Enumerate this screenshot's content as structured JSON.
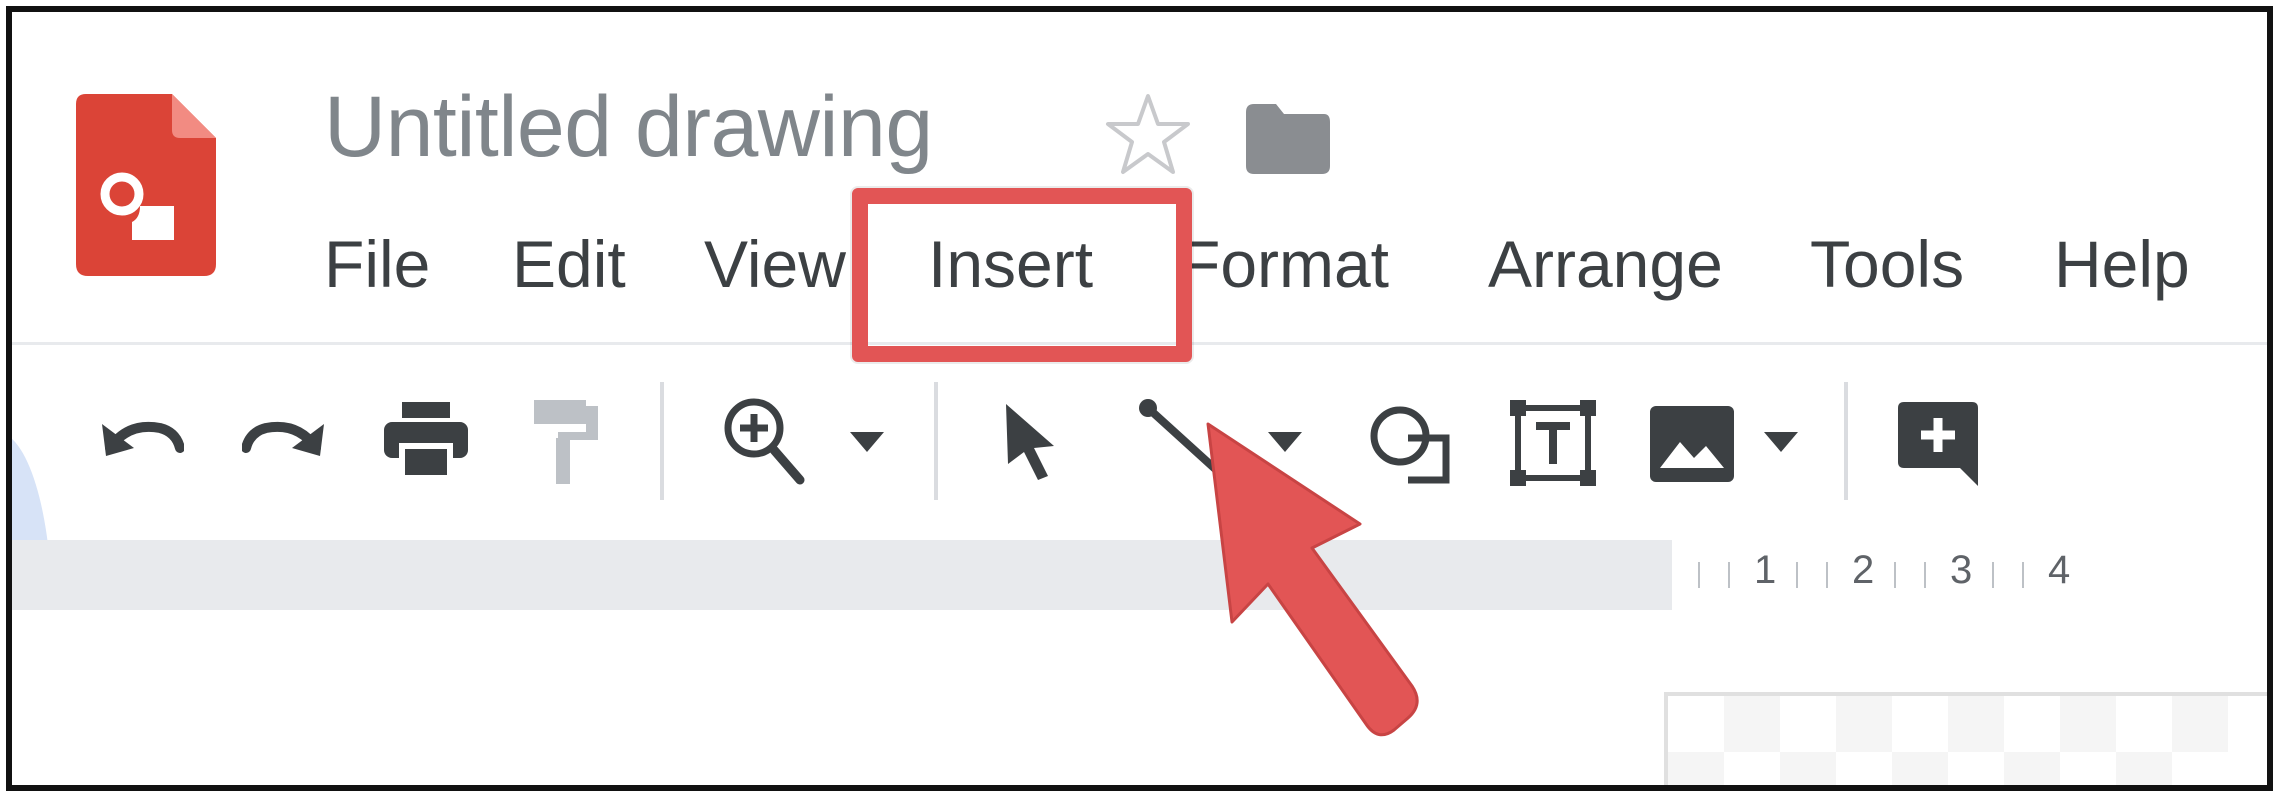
{
  "app": {
    "title": "Untitled drawing",
    "logo_icon": "google-drawings-logo-icon",
    "brand_color": "#db4437"
  },
  "header": {
    "star_icon": "star-icon",
    "folder_icon": "folder-icon"
  },
  "menu": {
    "items": [
      "File",
      "Edit",
      "View",
      "Insert",
      "Format",
      "Arrange",
      "Tools",
      "Help"
    ],
    "highlighted": "Insert",
    "highlight_color": "#e25555"
  },
  "toolbar": {
    "tools": [
      "undo-icon",
      "redo-icon",
      "print-icon",
      "paint-format-icon",
      "zoom-icon",
      "zoom-dropdown-icon",
      "select-icon",
      "line-icon",
      "line-dropdown-icon",
      "shape-icon",
      "text-box-icon",
      "image-icon",
      "image-dropdown-icon",
      "comment-icon"
    ]
  },
  "ruler": {
    "numbers": [
      "1",
      "2",
      "3",
      "4"
    ]
  },
  "annotation": {
    "arrow_icon": "red-pointer-arrow",
    "arrow_color": "#e25555"
  }
}
